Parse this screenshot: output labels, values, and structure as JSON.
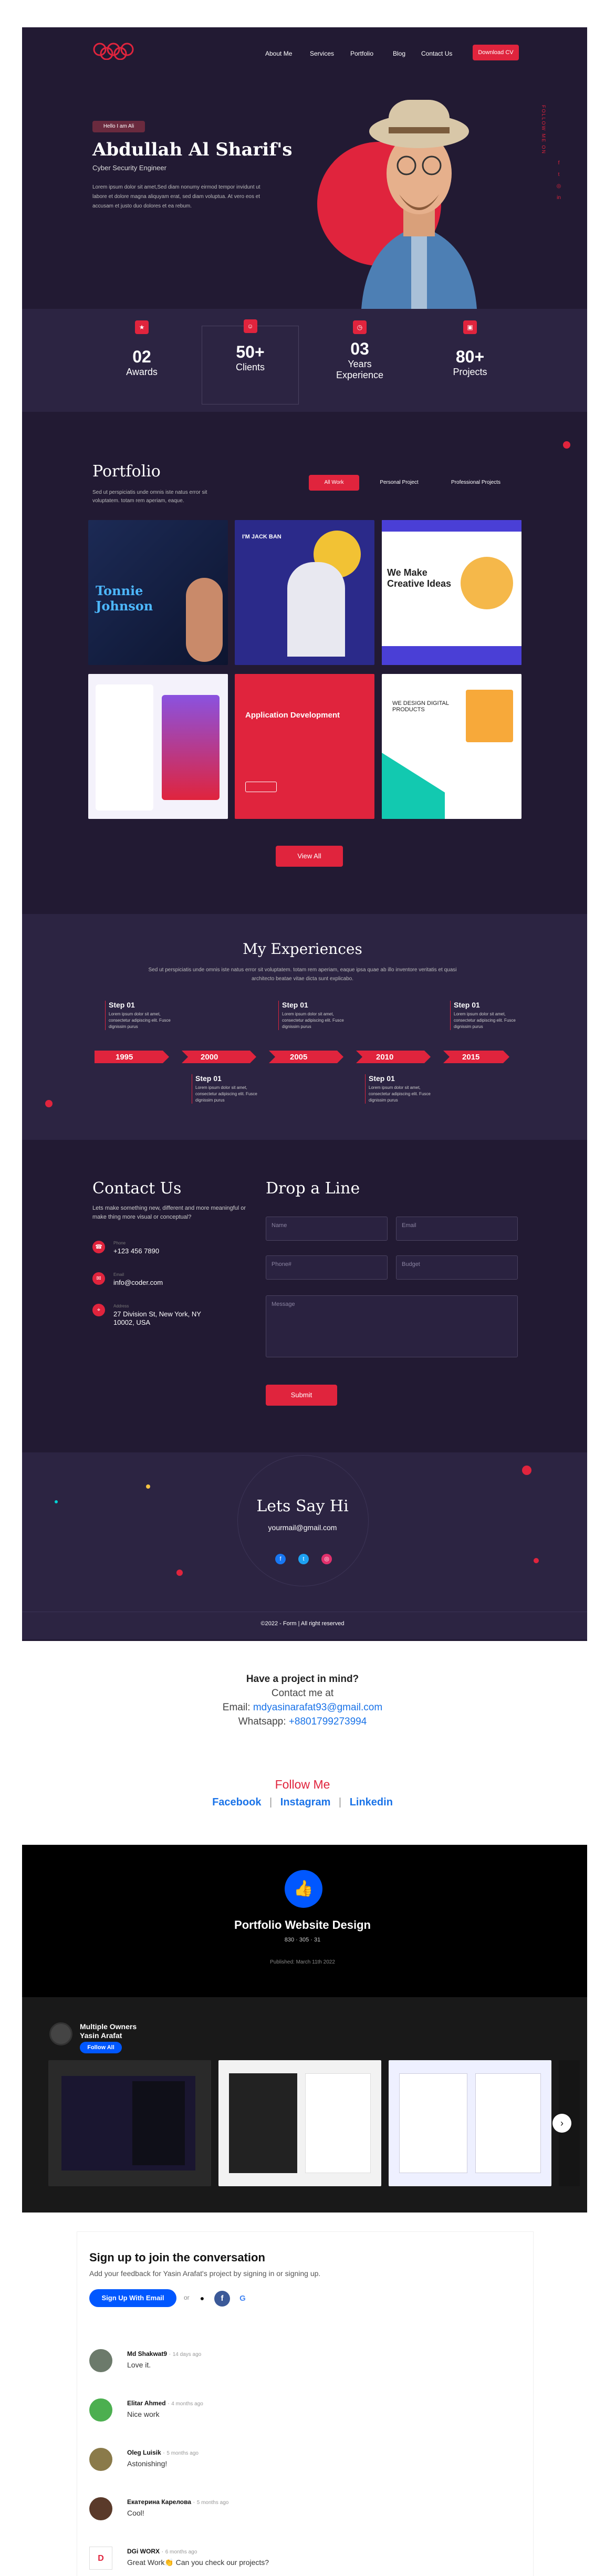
{
  "nav": {
    "logo_icon": "olympic-rings-logo",
    "items": [
      "About Me",
      "Services",
      "Portfolio",
      "Blog",
      "Contact Us"
    ],
    "cta": "Download CV"
  },
  "hero": {
    "tag": "Hello I am Ali",
    "name": "Abdullah Al Sharif's",
    "role": "Cyber Security Engineer",
    "desc": "Lorem ipsum dolor sit amet,Sed diam nonumy eirmod tempor invidunt ut labore et dolore magna aliquyam erat, sed diam voluptua. At vero eos et accusam et justo duo dolores et ea rebum.",
    "social_label": "FOLLOW ME ON"
  },
  "stats": [
    {
      "num": "02",
      "label": "Awards"
    },
    {
      "num": "50+",
      "label": "Clients"
    },
    {
      "num": "03",
      "label": "Years Experience"
    },
    {
      "num": "80+",
      "label": "Projects"
    }
  ],
  "portfolio": {
    "title": "Portfolio",
    "desc": "Sed ut perspiciatis unde omnis iste natus error sit voluptatem. totam rem aperiam, eaque.",
    "filters": [
      "All Work",
      "Personal Project",
      "Professional Projects"
    ],
    "tiles": [
      {
        "t": "Tonnie Johnson"
      },
      {
        "t": "I'M JACK BAN"
      },
      {
        "t": "We Make Creative Ideas"
      },
      {
        "t": ""
      },
      {
        "t": "Application Development"
      },
      {
        "t": "WE DESIGN DIGITAL PRODUCTS"
      }
    ],
    "view_all": "View All"
  },
  "exp": {
    "title": "My Experiences",
    "desc": "Sed ut perspiciatis unde omnis iste natus error sit voluptatem. totam rem aperiam, eaque ipsa quae ab illo inventore veritatis et quasi architecto beatae vitae dicta sunt explicabo.",
    "years": [
      "1995",
      "2000",
      "2005",
      "2010",
      "2015"
    ],
    "step": "Step 01",
    "step_text": "Lorem ipsum dolor sit amet, consectetur adipiscing elit. Fusce dignissim purus"
  },
  "contact": {
    "title": "Contact Us",
    "desc": "Lets make something new, different and more meaningful or make thing more visual or conceptual?",
    "phone_label": "Phone",
    "phone": "+123 456 7890",
    "email_label": "Email",
    "email": "info@coder.com",
    "addr_label": "Address",
    "address": "27 Division St, New York, NY 10002, USA",
    "form_title": "Drop a Line",
    "ph_name": "Name",
    "ph_email": "Email",
    "ph_phone": "Phone#",
    "ph_budget": "Budget",
    "ph_message": "Message",
    "submit": "Submit"
  },
  "hi": {
    "title": "Lets Say Hi",
    "email": "yourmail@gmail.com",
    "copyright": "©2022 - Form  |  All right reserved"
  },
  "project": {
    "q": "Have a project in mind?",
    "contact": "Contact me at",
    "email_label": "Email:",
    "email": "mdyasinarafat93@gmail.com",
    "wa_label": "Whatsapp:",
    "wa": "+8801799273994",
    "follow": "Follow Me",
    "links": [
      "Facebook",
      "Instagram",
      "Linkedin"
    ]
  },
  "behance": {
    "title": "Portfolio Website Design",
    "stats": "830  ·  305  ·  31",
    "published": "Published: March 11th 2022",
    "owners": "Multiple Owners",
    "owner2": "Yasin Arafat",
    "follow": "Follow All"
  },
  "comments": {
    "title": "Sign up to join the conversation",
    "sub": "Add your feedback for Yasin Arafat's project by signing in or signing up.",
    "signup": "Sign Up With Email",
    "or": "or",
    "items": [
      {
        "name": "Md Shakwat9",
        "time": "14 days ago",
        "text": "Love it."
      },
      {
        "name": "Elitar Ahmed",
        "time": "4 months ago",
        "text": "Nice work"
      },
      {
        "name": "Oleg Luisik",
        "time": "5 months ago",
        "text": "Astonishing!"
      },
      {
        "name": "Екатерина Карелова",
        "time": "5 months ago",
        "text": "Cool!"
      },
      {
        "name": "DGi WORX",
        "time": "6 months ago",
        "text": "Great Work👏  Can you check our projects?"
      }
    ]
  },
  "colors": {
    "accent": "#e0243d",
    "dark": "#221a33",
    "blue": "#0057ff"
  }
}
